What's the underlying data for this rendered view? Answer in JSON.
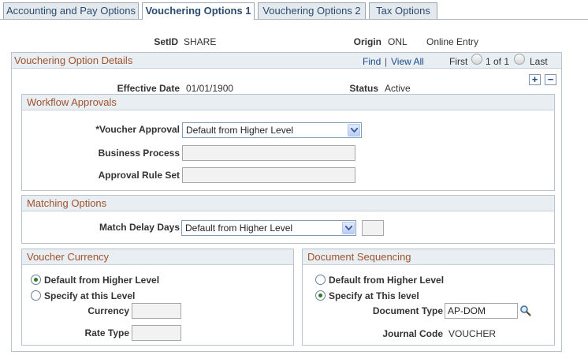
{
  "tabs": [
    {
      "label": "Accounting and Pay Options",
      "active": false
    },
    {
      "label": "Vouchering Options 1",
      "active": true
    },
    {
      "label": "Vouchering Options 2",
      "active": false
    },
    {
      "label": "Tax Options",
      "active": false
    }
  ],
  "header": {
    "setid_label": "SetID",
    "setid_value": "SHARE",
    "origin_label": "Origin",
    "origin_code": "ONL",
    "origin_desc": "Online Entry"
  },
  "details": {
    "title": "Vouchering Option Details",
    "find": "Find",
    "sep": "|",
    "view_all": "View All",
    "first": "First",
    "page_of": "1 of 1",
    "last": "Last",
    "effdt_label": "Effective Date",
    "effdt_value": "01/01/1900",
    "status_label": "Status",
    "status_value": "Active",
    "add_row": "+",
    "delete_row": "−"
  },
  "workflow": {
    "title": "Workflow Approvals",
    "voucher_approval_label": "*Voucher Approval",
    "voucher_approval_value": "Default from Higher Level",
    "business_process_label": "Business Process",
    "business_process_value": "",
    "approval_rule_label": "Approval Rule Set",
    "approval_rule_value": ""
  },
  "matching": {
    "title": "Matching Options",
    "delay_label": "Match Delay Days",
    "delay_value": "Default from Higher Level",
    "days_value": ""
  },
  "currency": {
    "title": "Voucher Currency",
    "opt_default": "Default from Higher Level",
    "opt_specify": "Specify at this Level",
    "selected": "default",
    "currency_label": "Currency",
    "currency_value": "",
    "rate_type_label": "Rate Type",
    "rate_type_value": ""
  },
  "sequencing": {
    "title": "Document Sequencing",
    "opt_default": "Default from Higher Level",
    "opt_specify": "Specify at This level",
    "selected": "specify",
    "doc_type_label": "Document Type",
    "doc_type_value": "AP-DOM",
    "journal_label": "Journal Code",
    "journal_value": "VOUCHER"
  },
  "colors": {
    "section_title": "#a0522d",
    "link": "#1a4b8a",
    "tab_text": "#2b4b6e"
  }
}
